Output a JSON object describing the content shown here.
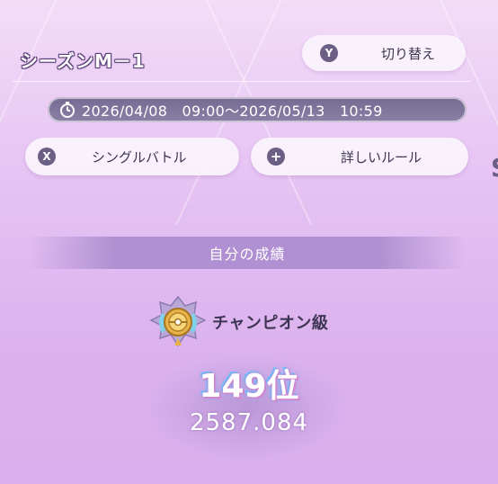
{
  "season": {
    "title": "シーズンM－1"
  },
  "switch_button": {
    "key": "Y",
    "label": "切り替え"
  },
  "period": {
    "text": "2026/04/08　09:00～2026/05/13　10:59"
  },
  "rule_buttons": [
    {
      "key": "X",
      "label": "シングルバトル"
    },
    {
      "key": "+",
      "label": "詳しいルール"
    }
  ],
  "results": {
    "header": "自分の成績",
    "rank_name": "チャンピオン級",
    "position": "149位",
    "rating": "2587.084"
  },
  "colors": {
    "accent": "#6b5f86",
    "period_bar": "#7a6e96",
    "background": "#e7c4f3"
  }
}
